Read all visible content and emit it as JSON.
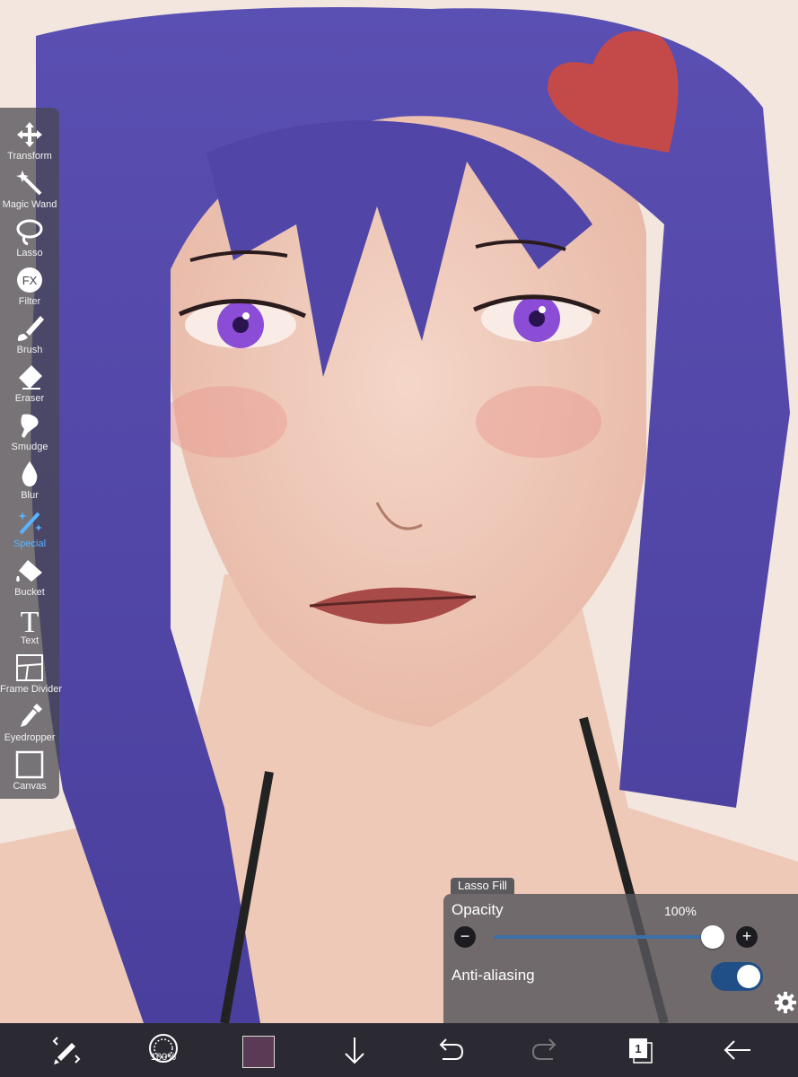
{
  "tools": [
    {
      "label": "Transform",
      "icon": "move-arrows-icon",
      "active": false
    },
    {
      "label": "Magic Wand",
      "icon": "magic-wand-icon",
      "active": false
    },
    {
      "label": "Lasso",
      "icon": "lasso-icon",
      "active": false
    },
    {
      "label": "Filter",
      "icon": "fx-icon",
      "active": false,
      "glyph": "FX"
    },
    {
      "label": "Brush",
      "icon": "brush-icon",
      "active": false
    },
    {
      "label": "Eraser",
      "icon": "eraser-icon",
      "active": false
    },
    {
      "label": "Smudge",
      "icon": "smudge-icon",
      "active": false
    },
    {
      "label": "Blur",
      "icon": "droplet-icon",
      "active": false
    },
    {
      "label": "Special",
      "icon": "sparkle-wand-icon",
      "active": true
    },
    {
      "label": "Bucket",
      "icon": "bucket-icon",
      "active": false
    },
    {
      "label": "Text",
      "icon": "text-icon",
      "active": false,
      "glyph": "T"
    },
    {
      "label": "Frame Divider",
      "icon": "frame-divider-icon",
      "active": false
    },
    {
      "label": "Eyedropper",
      "icon": "eyedropper-icon",
      "active": false
    },
    {
      "label": "Canvas",
      "icon": "canvas-icon",
      "active": false
    }
  ],
  "panel": {
    "tab_label": "Lasso Fill",
    "opacity_label": "Opacity",
    "opacity_value": "100%",
    "opacity_fraction": 1.0,
    "minus": "−",
    "plus": "+",
    "antialias_label": "Anti-aliasing",
    "antialias_on": true
  },
  "bottombar": {
    "brush_size_pct": "100%",
    "current_color": "#5a3a55",
    "layer_count": "1"
  },
  "colors": {
    "accent": "#5ab4ff",
    "slider": "#3b6fa8",
    "toggle": "#1f4f86"
  }
}
